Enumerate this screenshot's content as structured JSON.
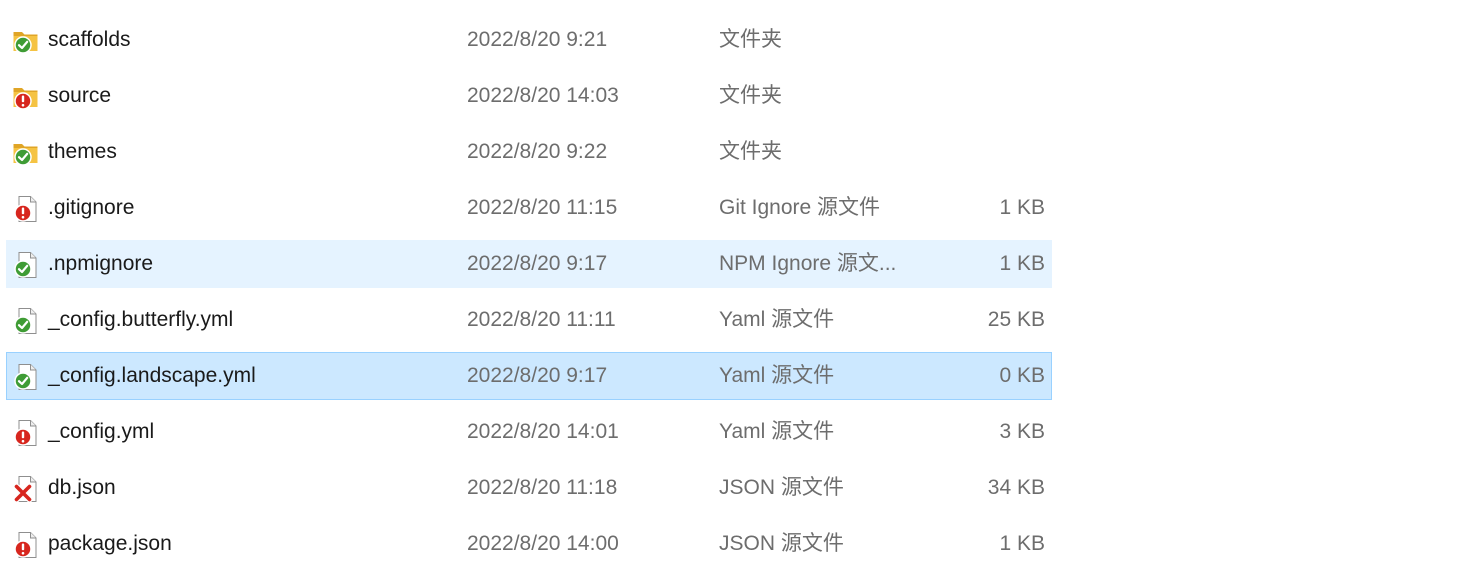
{
  "files": [
    {
      "name": "scaffolds",
      "date": "2022/8/20 9:21",
      "type": "文件夹",
      "size": "",
      "kind": "folder",
      "status": "ok",
      "state": ""
    },
    {
      "name": "source",
      "date": "2022/8/20 14:03",
      "type": "文件夹",
      "size": "",
      "kind": "folder",
      "status": "modified",
      "state": ""
    },
    {
      "name": "themes",
      "date": "2022/8/20 9:22",
      "type": "文件夹",
      "size": "",
      "kind": "folder",
      "status": "ok",
      "state": ""
    },
    {
      "name": ".gitignore",
      "date": "2022/8/20 11:15",
      "type": "Git Ignore 源文件",
      "size": "1 KB",
      "kind": "file",
      "status": "modified",
      "state": ""
    },
    {
      "name": ".npmignore",
      "date": "2022/8/20 9:17",
      "type": "NPM Ignore 源文...",
      "size": "1 KB",
      "kind": "file",
      "status": "ok",
      "state": "hover"
    },
    {
      "name": "_config.butterfly.yml",
      "date": "2022/8/20 11:11",
      "type": "Yaml 源文件",
      "size": "25 KB",
      "kind": "file",
      "status": "ok",
      "state": ""
    },
    {
      "name": "_config.landscape.yml",
      "date": "2022/8/20 9:17",
      "type": "Yaml 源文件",
      "size": "0 KB",
      "kind": "file",
      "status": "ok",
      "state": "selected"
    },
    {
      "name": "_config.yml",
      "date": "2022/8/20 14:01",
      "type": "Yaml 源文件",
      "size": "3 KB",
      "kind": "file",
      "status": "modified",
      "state": ""
    },
    {
      "name": "db.json",
      "date": "2022/8/20 11:18",
      "type": "JSON 源文件",
      "size": "34 KB",
      "kind": "file",
      "status": "deleted",
      "state": ""
    },
    {
      "name": "package.json",
      "date": "2022/8/20 14:00",
      "type": "JSON 源文件",
      "size": "1 KB",
      "kind": "file",
      "status": "modified",
      "state": ""
    }
  ],
  "colors": {
    "folder": "#f5c343",
    "ok_badge": "#3f9c35",
    "modified_badge": "#d7261e",
    "deleted_badge": "#d7261e",
    "hover_bg": "#e5f3ff",
    "selected_bg": "#cce8ff",
    "selected_border": "#99d1ff"
  }
}
